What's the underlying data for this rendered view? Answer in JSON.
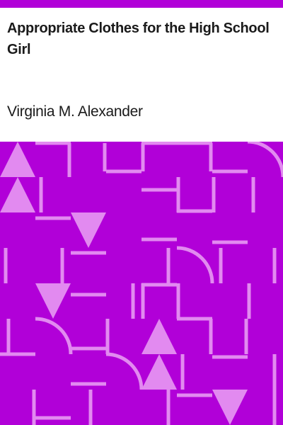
{
  "book": {
    "title": "Appropriate Clothes for the High School Girl",
    "author": "Virginia M. Alexander"
  },
  "colors": {
    "background": "#ffffff",
    "accent": "#b100d8",
    "pattern_base": "#b100d8",
    "pattern_light": "#e28af0",
    "text": "#1a1a1a"
  }
}
